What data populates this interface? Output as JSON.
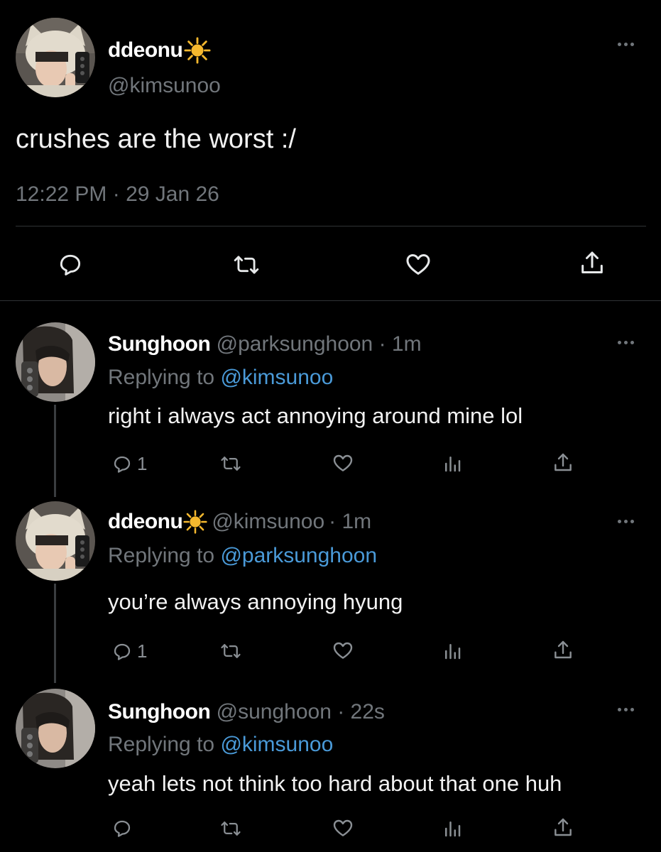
{
  "main_tweet": {
    "display_name": "ddeonu",
    "name_emoji": "☀️",
    "handle": "@kimsunoo",
    "text": "crushes are the worst :/",
    "timestamp": "12:22 PM · 29 Jan 26"
  },
  "replies": [
    {
      "display_name": "Sunghoon",
      "handle": "@parksunghoon",
      "time": "· 1m",
      "replying_prefix": "Replying to",
      "replying_to": "@kimsunoo",
      "text": "right i always act annoying around mine lol",
      "reply_count": "1"
    },
    {
      "display_name": "ddeonu",
      "name_emoji": "☀️",
      "handle": "@kimsunoo",
      "time": "· 1m",
      "replying_prefix": "Replying to",
      "replying_to": "@parksunghoon",
      "text": "you’re always annoying hyung",
      "reply_count": "1"
    },
    {
      "display_name": "Sunghoon",
      "handle": "@sunghoon",
      "time": "· 22s",
      "replying_prefix": "Replying to",
      "replying_to": "@kimsunoo",
      "text": "yeah lets not think too hard about that one huh",
      "reply_count": ""
    }
  ],
  "colors": {
    "background": "#000000",
    "text": "#e7e9ea",
    "muted": "#71767b",
    "link": "#4a9ad8",
    "sun": "#f5b82e"
  },
  "icons": [
    "reply-icon",
    "retweet-icon",
    "like-icon",
    "views-icon",
    "share-icon",
    "more-icon",
    "sun-emoji"
  ]
}
